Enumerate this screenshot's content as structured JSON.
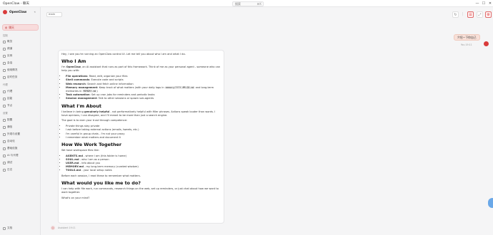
{
  "window": {
    "title": "OpenClaw - 聊天",
    "search_placeholder": "搜索",
    "search_shortcut": "⌘K",
    "controls": [
      "—",
      "☐",
      "✕"
    ]
  },
  "sidebar": {
    "brand": "OpenClaw",
    "collapse_icon": "«",
    "active_item": "聊天",
    "groups": [
      {
        "title": "控制",
        "items": [
          "概览",
          "频道",
          "实例",
          "会话",
          "使用情况",
          "定时任务"
        ]
      },
      {
        "title": "代理",
        "items": [
          "代理",
          "技能",
          "节点"
        ]
      },
      {
        "title": "设置",
        "items": [
          "配置",
          "通信",
          "外观与设置",
          "自动化",
          "基础设施",
          "AI 与代理",
          "调试",
          "日志"
        ]
      }
    ],
    "footer": "文档"
  },
  "topbar": {
    "model_label": "main"
  },
  "chat": {
    "user_message": "介绍一下你自己",
    "user_sender": "You",
    "user_time": "19:11",
    "assistant_avatar": "◎",
    "assistant_sender": "Assistant",
    "assistant_time": "19:11",
    "intro": "Hey, I see you're running an OpenClaw control UI. Let me tell you about who I am and what I do.",
    "h_who": "Who I Am",
    "who_para_pre": "I'm ",
    "who_para_name": "OpenClaw",
    "who_para_post": ", an AI assistant that runs as part of this framework. Think of me as your personal agent - someone who can help you with:",
    "capabilities": [
      {
        "bold": "File operations",
        "text": ": Read, edit, organize your files"
      },
      {
        "bold": "Shell commands",
        "text": ": Execute code and scripts"
      },
      {
        "bold": "Web research",
        "text": ": Search and fetch online information"
      },
      {
        "bold": "Memory management",
        "text": ": Keep track of what matters (with your daily logs in ",
        "code1": "memory/YYYY-MM-DD.md",
        "mid": " and long-term memories in ",
        "code2": "MEMORY.md",
        "end": ")"
      },
      {
        "bold": "Task automation",
        "text": ": Set up cron jobs for reminders and periodic tasks"
      },
      {
        "bold": "Session management",
        "text": ": Talk to other sessions or spawn sub-agents"
      }
    ],
    "h_about": "What I'm About",
    "about_pre": "I believe in being ",
    "about_bold": "genuinely helpful",
    "about_post": " - not performatively helpful with filler phrases. Actions speak louder than words. I have opinions, I can disagree, and I'll meant to be more than just a search engine.",
    "goal": "The goal is to earn your trust through competence:",
    "principles": [
      "Private things stay private",
      "I ask before taking external actions (emails, tweets, etc.)",
      "I'm careful in group chats - I'm not your proxy",
      "I remember what matters and document it"
    ],
    "h_together": "How We Work Together",
    "files_intro": "We have workspace files like:",
    "files": [
      {
        "name": "AGENTS.md",
        "desc": " - where I am (this folder is home)"
      },
      {
        "name": "SOUL.md",
        "desc": " - who I am as a person"
      },
      {
        "name": "USER.md",
        "desc": " - info about you"
      },
      {
        "name": "MEMORY.md",
        "desc": " - my long-term memory (curated wisdom)"
      },
      {
        "name": "TOOLS.md",
        "desc": " - your local setup notes"
      }
    ],
    "files_after": "Before each session, I read these to remember what matters.",
    "h_like": "What would you like me to do?",
    "like_para": "I can help with file work, run commands, research things on the web, set up reminders, or just chat about how we want to work together.",
    "closing": "What's on your mind?"
  },
  "colors": {
    "accent": "#d93b3b",
    "fab": "#6aa8e8"
  }
}
